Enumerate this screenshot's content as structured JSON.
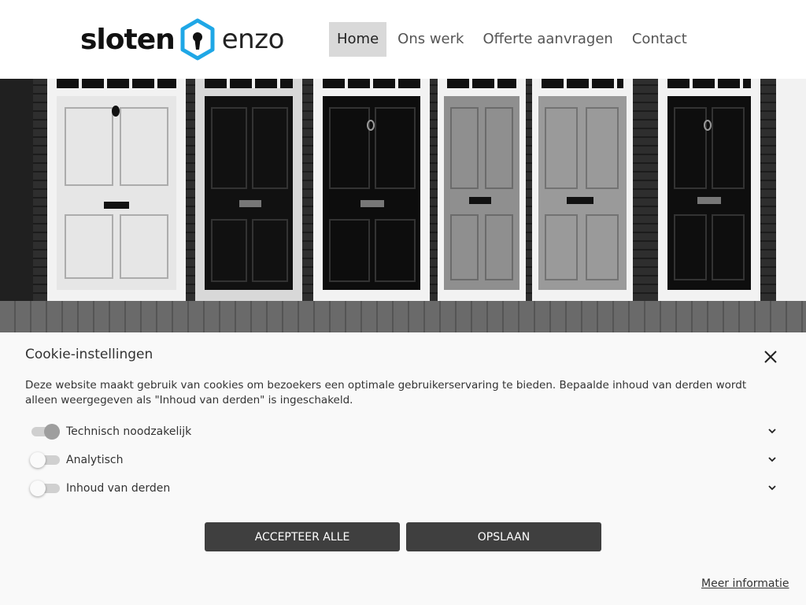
{
  "header": {
    "logo": {
      "word1": "sloten",
      "word2": "enzo",
      "mark_color": "#1fa7e6"
    },
    "nav": [
      {
        "label": "Home",
        "active": true
      },
      {
        "label": "Ons werk",
        "active": false
      },
      {
        "label": "Offerte aanvragen",
        "active": false
      },
      {
        "label": "Contact",
        "active": false
      }
    ]
  },
  "cookie": {
    "title": "Cookie-instellingen",
    "description": "Deze website maakt gebruik van cookies om bezoekers een optimale gebruikerservaring te bieden. Bepaalde inhoud van derden wordt alleen weergegeven als \"Inhoud van derden\" is ingeschakeld.",
    "options": [
      {
        "label": "Technisch noodzakelijk",
        "enabled": true
      },
      {
        "label": "Analytisch",
        "enabled": false
      },
      {
        "label": "Inhoud van derden",
        "enabled": false
      }
    ],
    "accept_all_label": "ACCEPTEER ALLE",
    "save_label": "OPSLAAN",
    "more_info_label": "Meer informatie",
    "close_icon": "close-icon",
    "button_color": "#3f3f3f"
  }
}
